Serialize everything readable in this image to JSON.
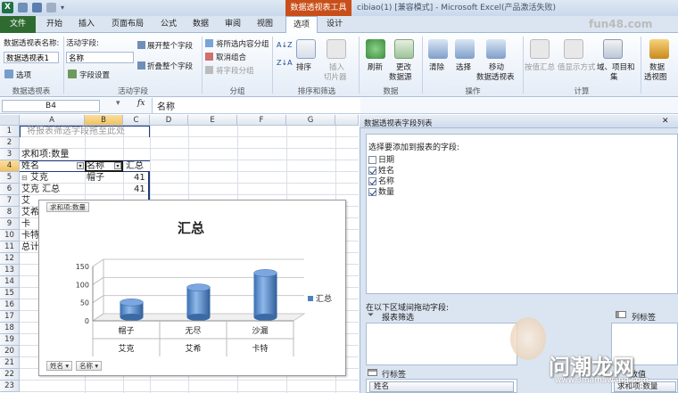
{
  "window": {
    "context_tab_group": "数据透视表工具",
    "title": "cibiao(1) [兼容模式] - Microsoft Excel(产品激活失败)",
    "watermark_top": "fun48.com",
    "watermark_bottom_cn": "问潮龙网",
    "watermark_bottom_url": "www.3mamawang.com"
  },
  "tabs": [
    "文件",
    "开始",
    "插入",
    "页面布局",
    "公式",
    "数据",
    "审阅",
    "视图",
    "选项",
    "设计"
  ],
  "ribbon": {
    "pivot": {
      "name_label": "数据透视表名称:",
      "name_value": "数据透视表1",
      "options_label": "选项",
      "group_label": "数据透视表"
    },
    "active_field": {
      "label": "活动字段:",
      "value": "名称",
      "settings_label": "字段设置",
      "expand_label": "展开整个字段",
      "collapse_label": "折叠整个字段",
      "group_label": "活动字段"
    },
    "group": {
      "group_selection": "将所选内容分组",
      "ungroup": "取消组合",
      "group_field": "将字段分组",
      "group_label": "分组"
    },
    "sort": {
      "sort_label": "排序",
      "slicer_label1": "插入",
      "slicer_label2": "切片器",
      "group_label": "排序和筛选"
    },
    "data": {
      "refresh_label": "刷新",
      "change_source1": "更改",
      "change_source2": "数据源",
      "group_label": "数据"
    },
    "actions": {
      "clear_label": "清除",
      "select_label": "选择",
      "move_label1": "移动",
      "move_label2": "数据透视表",
      "group_label": "操作"
    },
    "calc": {
      "summarize_label": "按值汇总",
      "show_values_label": "值显示方式",
      "fields_items_label1": "域、项目和",
      "fields_items_label2": "集",
      "group_label": "计算"
    },
    "tools": {
      "pivotchart1": "数据",
      "pivotchart2": "透视图"
    }
  },
  "formula_bar": {
    "cell_ref": "B4",
    "fx": "fx",
    "content": "名称"
  },
  "grid": {
    "columns": [
      "A",
      "B",
      "C",
      "D",
      "E",
      "F",
      "G"
    ],
    "rows": [
      "1",
      "2",
      "3",
      "4",
      "5",
      "6",
      "7",
      "8",
      "9",
      "10",
      "11",
      "12",
      "13",
      "14",
      "15",
      "16",
      "17",
      "18",
      "19",
      "20",
      "21",
      "22",
      "23"
    ],
    "drop_hint": "将报表筛选字段拖至此处",
    "a3": "求和项:数量",
    "a4": "姓名",
    "b4": "名称",
    "c4": "汇总",
    "a5": "艾克",
    "b5": "帽子",
    "c5": "41",
    "a6": "艾克 汇总",
    "c6": "41",
    "a7": "艾",
    "a8": "艾希",
    "a9": "卡",
    "a10": "卡特",
    "a11": "总计"
  },
  "chart": {
    "field_button_top": "求和项:数量",
    "field_button_name": "姓名",
    "field_button_item": "名称",
    "legend_label": "汇总",
    "series_color": "#4f81bd"
  },
  "chart_data": {
    "type": "bar",
    "title": "汇总",
    "categories": [
      [
        "帽子",
        "艾克"
      ],
      [
        "无尽",
        "艾希"
      ],
      [
        "沙漏",
        "卡特"
      ]
    ],
    "series": [
      {
        "name": "汇总",
        "values": [
          41,
          82,
          122
        ]
      }
    ],
    "ylim": [
      0,
      150
    ],
    "yticks": [
      "0",
      "50",
      "100",
      "150"
    ],
    "grid": true,
    "legend": "right",
    "style": "3d-cylinder"
  },
  "pane": {
    "title": "数据透视表字段列表",
    "choose_label": "选择要添加到报表的字段:",
    "fields": [
      {
        "label": "日期",
        "checked": false
      },
      {
        "label": "姓名",
        "checked": true
      },
      {
        "label": "名称",
        "checked": true
      },
      {
        "label": "数量",
        "checked": true
      }
    ],
    "drag_label": "在以下区域间拖动字段:",
    "filter_label": "报表筛选",
    "column_label": "列标签",
    "row_label": "行标签",
    "values_label": "数值",
    "row_item": "姓名",
    "value_item": "求和项:数量"
  }
}
